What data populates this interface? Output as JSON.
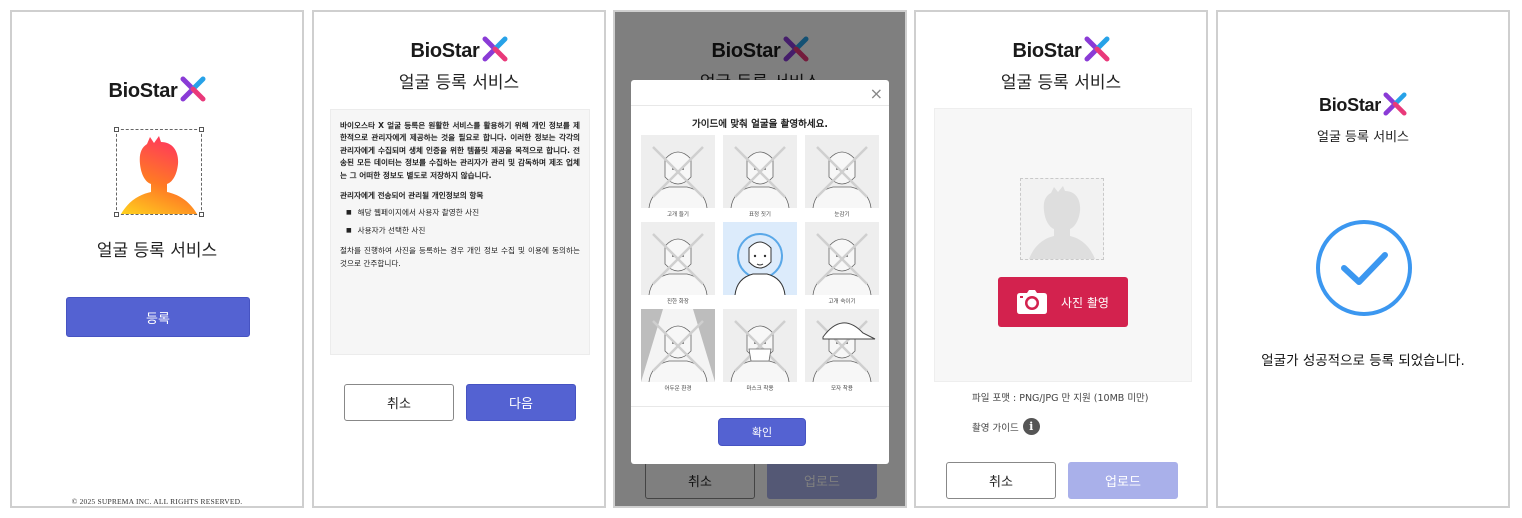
{
  "brand": {
    "name": "BioStar"
  },
  "service_title": "얼굴 등록 서비스",
  "intro": {
    "register_button": "등록",
    "copyright": "© 2025 SUPREMA INC. ALL RIGHTS RESERVED."
  },
  "consent": {
    "paragraph1": "바이오스타 X 얼굴 등록은 원활한 서비스를 활용하기 위해 개인 정보를 제한적으로 관리자에게 제공하는 것을 필요로 합니다. 이러한 정보는 각각의 관리자에게 수집되며 생체 인증을 위한 템플릿 제공을 목적으로 합니다. 전송된 모든 데이터는 정보를 수집하는 관리자가 관리 및 감독하며 제조 업체는 그 어떠한 정보도 별도로 저장하지 않습니다.",
    "list_heading": "관리자에게 전송되어 관리될 개인정보의 항목",
    "items": [
      "해당 웹페이지에서 사용자 촬영한 사진",
      "사용자가 선택한 사진"
    ],
    "paragraph2": "절차를 진행하여 사진을 등록하는 경우 개인 정보 수집 및 이용에 동의하는 것으로 간주합니다.",
    "cancel_button": "취소",
    "next_button": "다음"
  },
  "guide_modal": {
    "close_icon": "×",
    "title": "가이드에 맞춰 얼굴을 촬영하세요.",
    "cells": [
      {
        "label": "고개 들기",
        "ok": false,
        "icon": "face-tilt-up-icon"
      },
      {
        "label": "표정 짓기",
        "ok": false,
        "icon": "face-expression-icon"
      },
      {
        "label": "눈감기",
        "ok": false,
        "icon": "face-eyes-closed-icon"
      },
      {
        "label": "진한 화장",
        "ok": false,
        "icon": "face-heavy-makeup-icon"
      },
      {
        "label": "",
        "ok": true,
        "icon": "face-correct-icon"
      },
      {
        "label": "고개 숙이기",
        "ok": false,
        "icon": "face-tilt-down-icon"
      },
      {
        "label": "어두운 환경",
        "ok": false,
        "icon": "face-dark-environment-icon"
      },
      {
        "label": "마스크 착용",
        "ok": false,
        "icon": "face-mask-icon"
      },
      {
        "label": "모자 착용",
        "ok": false,
        "icon": "face-hat-icon"
      }
    ],
    "confirm_button": "확인",
    "bg_cancel_button": "취소",
    "bg_upload_button": "업로드"
  },
  "upload": {
    "camera_button": "사진 촬영",
    "file_format_note": "파일 포맷 : PNG/JPG 만 지원 (10MB 미만)",
    "guide_label": "촬영 가이드",
    "cancel_button": "취소",
    "upload_button": "업로드"
  },
  "success": {
    "message": "얼굴가 성공적으로 등록 되었습니다."
  },
  "colors": {
    "primary": "#5462d2",
    "camera": "#d3224e",
    "success": "#3b97f0"
  }
}
